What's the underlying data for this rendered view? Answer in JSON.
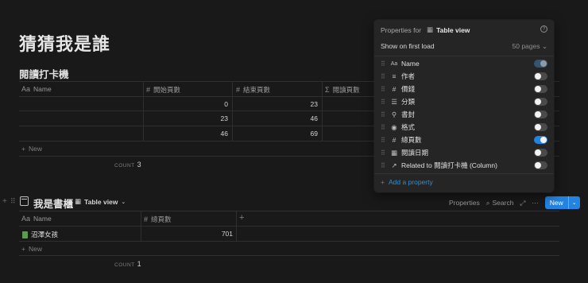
{
  "page": {
    "title": "猜猜我是誰"
  },
  "db1": {
    "title": "閱讀打卡機",
    "columns": [
      {
        "icon": "Aa",
        "label": "Name"
      },
      {
        "icon": "#",
        "label": "開始頁數"
      },
      {
        "icon": "#",
        "label": "結束頁數"
      },
      {
        "icon": "Σ",
        "label": "閱讀頁數"
      }
    ],
    "rows": [
      {
        "start": "0",
        "end": "23"
      },
      {
        "start": "23",
        "end": "46"
      },
      {
        "start": "46",
        "end": "69"
      }
    ],
    "new_label": "New",
    "count_label": "COUNT",
    "count_value": "3"
  },
  "db2": {
    "title": "我是書櫃",
    "view_label": "Table view",
    "toolbar": {
      "properties": "Properties",
      "search": "Search",
      "new": "New"
    },
    "columns": [
      {
        "icon": "Aa",
        "label": "Name"
      },
      {
        "icon": "#",
        "label": "總頁數"
      }
    ],
    "rows": [
      {
        "name": "沼澤女孩",
        "pages": "701"
      }
    ],
    "new_label": "New",
    "count_label": "COUNT",
    "count_value": "1"
  },
  "popup": {
    "title_prefix": "Properties for",
    "view_name": "Table view",
    "help": "?",
    "first_load_label": "Show on first load",
    "first_load_value": "50 pages",
    "properties": [
      {
        "icon": "Aa",
        "label": "Name",
        "state": "locked"
      },
      {
        "icon": "≡",
        "label": "作者",
        "state": "off"
      },
      {
        "icon": "#",
        "label": "價錢",
        "state": "off"
      },
      {
        "icon": "☰",
        "label": "分類",
        "state": "off"
      },
      {
        "icon": "⚲",
        "label": "書封",
        "state": "off"
      },
      {
        "icon": "◉",
        "label": "格式",
        "state": "off"
      },
      {
        "icon": "#",
        "label": "總頁數",
        "state": "on"
      },
      {
        "icon": "▦",
        "label": "閱讀日期",
        "state": "off"
      },
      {
        "icon": "↗",
        "label": "Related to 閱讀打卡機 (Column)",
        "state": "off"
      }
    ],
    "add_property": "Add a property"
  },
  "colors": {
    "accent": "#2383e2",
    "background": "#191919",
    "popup": "#252525"
  }
}
